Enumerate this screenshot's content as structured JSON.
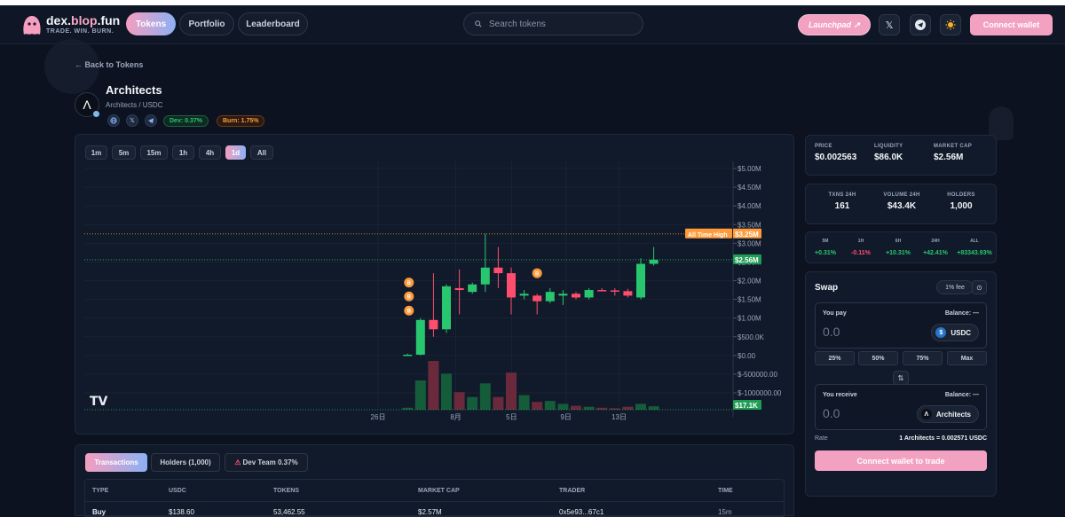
{
  "colors": {
    "accent_pink": "#f2a1c1",
    "accent_blue": "#8db0f4",
    "up": "#28c76f",
    "down": "#ff4d6d",
    "bg": "#0c1220"
  },
  "nav": {
    "brand_name": "dex.",
    "brand_accent": "blop",
    "brand_tld": ".fun",
    "brand_tagline": "TRADE. WIN. BURN.",
    "links": [
      "Tokens",
      "Portfolio",
      "Leaderboard"
    ],
    "active_link": "Tokens",
    "search_placeholder": "Search tokens",
    "launchpad": "Launchpad ↗",
    "x_icon": "𝕏",
    "connect": "Connect wallet"
  },
  "back_link": "← Back to Tokens",
  "token": {
    "name": "Architects",
    "pair": "Architects / USDC",
    "dev_badge": "Dev: 0.37%",
    "burn_badge": "Burn: 1.75%",
    "social_icons": [
      "globe-icon",
      "x-icon",
      "telegram-icon"
    ],
    "symbol_glyph": "Λ",
    "usdc_glyph": "$"
  },
  "chart": {
    "timeframes": [
      "1m",
      "5m",
      "15m",
      "1h",
      "4h",
      "1d",
      "All"
    ],
    "active_timeframe": "1d",
    "watermark": "TV",
    "ath_label": "All Time High",
    "ath_value": "$3.25M",
    "current_value": "$2.56M",
    "volume_value": "$17.1K",
    "event_marker": "B"
  },
  "chart_data": {
    "type": "candlestick",
    "y_ticks": [
      "$5.00M",
      "$4.50M",
      "$4.00M",
      "$3.50M",
      "$3.00M",
      "$2.50M",
      "$2.00M",
      "$1.50M",
      "$1.00M",
      "$500.0K",
      "$0.00",
      "$-500000.00",
      "$-1000000.00"
    ],
    "y_tick_values": [
      5.0,
      4.5,
      4.0,
      3.5,
      3.0,
      2.5,
      2.0,
      1.5,
      1.0,
      0.5,
      0.0,
      -0.5,
      -1.0
    ],
    "x_ticks": [
      "26日",
      "8月",
      "5日",
      "9日",
      "13日"
    ],
    "x_tick_index": [
      0,
      6,
      10.3,
      14.5,
      18.6
    ],
    "ath": 3.25,
    "current": 2.56,
    "candles": [
      {
        "o": 0.0,
        "h": 0.0,
        "l": 0.0,
        "c": 0.0,
        "v": 0
      },
      {
        "o": 0.0,
        "h": 0.0,
        "l": 0.0,
        "c": 0.0,
        "v": 0
      },
      {
        "o": 0.02,
        "h": 0.05,
        "l": 0.0,
        "c": 0.02,
        "v": 0.2
      },
      {
        "o": 0.02,
        "h": 1.0,
        "l": 0.0,
        "c": 0.95,
        "v": 3.0
      },
      {
        "o": 0.95,
        "h": 2.2,
        "l": 0.5,
        "c": 0.7,
        "v": 5.0
      },
      {
        "o": 0.7,
        "h": 1.9,
        "l": 0.6,
        "c": 1.85,
        "v": 3.7
      },
      {
        "o": 1.8,
        "h": 2.3,
        "l": 1.1,
        "c": 1.75,
        "v": 1.8
      },
      {
        "o": 1.7,
        "h": 1.95,
        "l": 1.65,
        "c": 1.9,
        "v": 1.3
      },
      {
        "o": 1.9,
        "h": 3.25,
        "l": 1.7,
        "c": 2.35,
        "v": 2.7
      },
      {
        "o": 2.35,
        "h": 2.9,
        "l": 1.8,
        "c": 2.2,
        "v": 1.3
      },
      {
        "o": 2.2,
        "h": 2.35,
        "l": 1.1,
        "c": 1.55,
        "v": 3.8
      },
      {
        "o": 1.6,
        "h": 1.75,
        "l": 1.5,
        "c": 1.65,
        "v": 1.5
      },
      {
        "o": 1.6,
        "h": 1.65,
        "l": 1.1,
        "c": 1.45,
        "v": 0.8
      },
      {
        "o": 1.45,
        "h": 1.8,
        "l": 1.4,
        "c": 1.7,
        "v": 0.9
      },
      {
        "o": 1.6,
        "h": 1.75,
        "l": 1.35,
        "c": 1.65,
        "v": 0.6
      },
      {
        "o": 1.65,
        "h": 1.7,
        "l": 1.5,
        "c": 1.55,
        "v": 0.4
      },
      {
        "o": 1.55,
        "h": 1.8,
        "l": 1.5,
        "c": 1.75,
        "v": 0.3
      },
      {
        "o": 1.75,
        "h": 1.8,
        "l": 1.72,
        "c": 1.74,
        "v": 0.2
      },
      {
        "o": 1.74,
        "h": 1.8,
        "l": 1.6,
        "c": 1.72,
        "v": 0.15
      },
      {
        "o": 1.72,
        "h": 1.78,
        "l": 1.55,
        "c": 1.6,
        "v": 0.3
      },
      {
        "o": 1.55,
        "h": 2.6,
        "l": 1.5,
        "c": 2.45,
        "v": 0.6
      },
      {
        "o": 2.45,
        "h": 2.9,
        "l": 2.4,
        "c": 2.56,
        "v": 0.35
      }
    ],
    "markers_at_candle": [
      3,
      3,
      3,
      12
    ],
    "marker_prices": [
      1.95,
      1.58,
      1.2,
      2.2
    ]
  },
  "stats": {
    "price_label": "PRICE",
    "price": "$0.002563",
    "liquidity_label": "LIQUIDITY",
    "liquidity": "$86.0K",
    "mcap_label": "MARKET CAP",
    "mcap": "$2.56M",
    "txns_label": "TXNS 24H",
    "txns": "161",
    "volume_label": "VOLUME 24H",
    "volume": "$43.4K",
    "holders_label": "HOLDERS",
    "holders": "1,000"
  },
  "changes": [
    {
      "label": "5M",
      "value": "+0.31%",
      "dir": "pos"
    },
    {
      "label": "1H",
      "value": "-0.11%",
      "dir": "neg"
    },
    {
      "label": "6H",
      "value": "+10.31%",
      "dir": "pos"
    },
    {
      "label": "24H",
      "value": "+42.41%",
      "dir": "pos"
    },
    {
      "label": "ALL",
      "value": "+83343.93%",
      "dir": "pos"
    }
  ],
  "swap": {
    "title": "Swap",
    "fee": "1% fee",
    "you_pay": "You pay",
    "balance": "Balance: —",
    "pay_placeholder": "0.0",
    "pay_token": "USDC",
    "percents": [
      "25%",
      "50%",
      "75%",
      "Max"
    ],
    "you_receive": "You receive",
    "receive_placeholder": "0.0",
    "receive_token": "Architects",
    "rate_label": "Rate",
    "rate_value": "1 Architects = 0.002571 USDC",
    "button": "Connect wallet to trade"
  },
  "transactions": {
    "tabs": [
      "Transactions",
      "Holders (1,000)",
      "Dev Team 0.37%"
    ],
    "columns": [
      "TYPE",
      "USDC",
      "TOKENS",
      "MARKET CAP",
      "TRADER",
      "TIME"
    ],
    "rows": [
      {
        "type": "Buy",
        "usdc": "$138.60",
        "tokens": "53,462.55",
        "mcap": "$2.57M",
        "trader": "0x5e93...67c1",
        "time": "15m"
      }
    ]
  }
}
